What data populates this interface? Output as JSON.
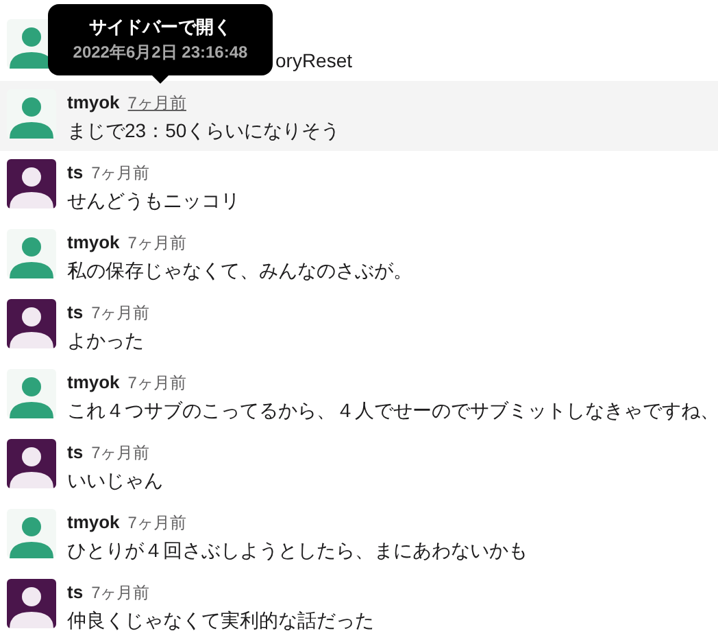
{
  "tooltip": {
    "title": "サイドバーで開く",
    "timestamp": "2022年6月2日 23:16:48"
  },
  "messages": [
    {
      "text": "oryReset",
      "color": "#2ea27a"
    },
    {
      "user": "tmyok",
      "time": "7ヶ月前",
      "text": "まじで23：50くらいになりそう",
      "color": "#2ea27a",
      "hovered": true
    },
    {
      "user": "ts",
      "time": "7ヶ月前",
      "text": "せんどうもニッコリ",
      "color": "#4a154b",
      "hovered": false
    },
    {
      "user": "tmyok",
      "time": "7ヶ月前",
      "text": "私の保存じゃなくて、みんなのさぶが。",
      "color": "#2ea27a",
      "hovered": false
    },
    {
      "user": "ts",
      "time": "7ヶ月前",
      "text": "よかった",
      "color": "#4a154b",
      "hovered": false
    },
    {
      "user": "tmyok",
      "time": "7ヶ月前",
      "text": "これ４つサブのこってるから、４人でせーのでサブミットしなきゃですね、",
      "color": "#2ea27a",
      "hovered": false
    },
    {
      "user": "ts",
      "time": "7ヶ月前",
      "text": "いいじゃん",
      "color": "#4a154b",
      "hovered": false
    },
    {
      "user": "tmyok",
      "time": "7ヶ月前",
      "text": "ひとりが４回さぶしようとしたら、まにあわないかも",
      "color": "#2ea27a",
      "hovered": false
    },
    {
      "user": "ts",
      "time": "7ヶ月前",
      "text": "仲良くじゃなくて実利的な話だった",
      "color": "#4a154b",
      "hovered": false
    }
  ]
}
